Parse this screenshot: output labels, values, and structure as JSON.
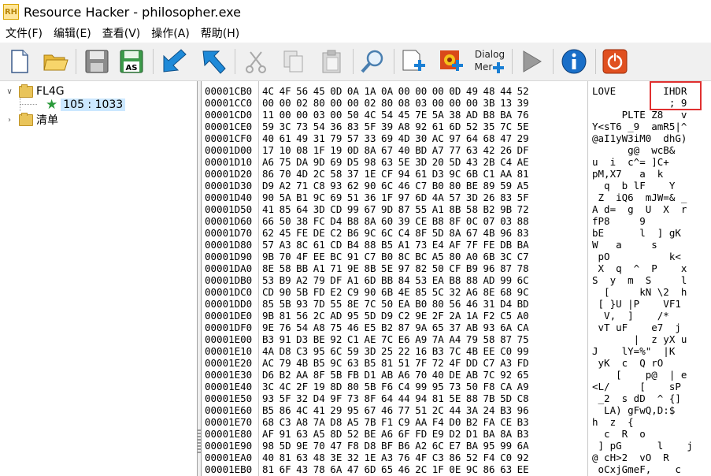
{
  "window": {
    "title": "Resource Hacker - philosopher.exe",
    "logo": "RH"
  },
  "menu": [
    "文件(F)",
    "编辑(E)",
    "查看(V)",
    "操作(A)",
    "帮助(H)"
  ],
  "toolbar": {
    "buttons": [
      "new-file-icon",
      "open-folder-icon",
      "save-icon",
      "save-as-icon",
      "back-arrow-icon",
      "forward-arrow-icon",
      "cut-icon",
      "copy-icon",
      "paste-icon",
      "search-icon",
      "add-resource-icon",
      "add-image-icon",
      "dialog-menu-icon",
      "play-icon",
      "info-icon",
      "power-icon"
    ],
    "save_as_label": "AS",
    "dialog_label_1": "Dialog",
    "dialog_label_2": "Mer"
  },
  "tree": {
    "root": "FL4G",
    "child": "105 : 1033",
    "sibling": "清单"
  },
  "hex": {
    "rows": [
      {
        "addr": "00001CB0",
        "bytes": "4C 4F 56 45 0D 0A 1A 0A 00 00 00 0D 49 48 44 52",
        "ascii": "LOVE        IHDR"
      },
      {
        "addr": "00001CC0",
        "bytes": "00 00 02 80 00 00 02 80 08 03 00 00 00 3B 13 39",
        "ascii": "             ; 9"
      },
      {
        "addr": "00001CD0",
        "bytes": "11 00 00 03 00 50 4C 54 45 7E 5A 38 AD B8 BA 76",
        "ascii": "     PLTE Z8   v"
      },
      {
        "addr": "00001CE0",
        "bytes": "59 3C 73 54 36 83 5F 39 A8 92 61 6D 52 35 7C 5E",
        "ascii": "Y<sT6 _9  amR5|^"
      },
      {
        "addr": "00001CF0",
        "bytes": "40 61 49 31 79 57 33 69 4D 30 AC 97 64 68 47 29",
        "ascii": "@aI1yW3iM0  dhG)"
      },
      {
        "addr": "00001D00",
        "bytes": "17 10 08 1F 19 0D 8A 67 40 BD A7 77 63 42 26 DF",
        "ascii": "      g@  wcB&"
      },
      {
        "addr": "00001D10",
        "bytes": "A6 75 DA 9D 69 D5 98 63 5E 3D 20 5D 43 2B C4 AE",
        "ascii": "u  i  c^= ]C+"
      },
      {
        "addr": "00001D20",
        "bytes": "86 70 4D 2C 58 37 1E CF 94 61 D3 9C 6B C1 AA 81",
        "ascii": "pM,X7   a  k"
      },
      {
        "addr": "00001D30",
        "bytes": "D9 A2 71 C8 93 62 90 6C 46 C7 B0 80 BE 89 59 A5",
        "ascii": "  q  b lF    Y"
      },
      {
        "addr": "00001D40",
        "bytes": "90 5A B1 9C 69 51 36 1F 97 6D 4A 57 3D 26 83 5F",
        "ascii": " Z  iQ6  mJW=& _"
      },
      {
        "addr": "00001D50",
        "bytes": "41 85 64 3D CD 99 67 9D 87 55 A1 8B 58 B2 9B 72",
        "ascii": "A d=  g  U  X  r"
      },
      {
        "addr": "00001D60",
        "bytes": "66 50 38 FC D4 B8 8A 60 39 CE B8 8F 0C 07 03 88",
        "ascii": "fP8     9"
      },
      {
        "addr": "00001D70",
        "bytes": "62 45 FE DE C2 B6 9C 6C C4 8F 5D 8A 67 4B 96 83",
        "ascii": "bE      l  ] gK"
      },
      {
        "addr": "00001D80",
        "bytes": "57 A3 8C 61 CD B4 88 B5 A1 73 E4 AF 7F FE DB BA",
        "ascii": "W   a     s"
      },
      {
        "addr": "00001D90",
        "bytes": "9B 70 4F EE BC 91 C7 B0 8C BC A5 80 A0 6B 3C C7",
        "ascii": " pO          k<"
      },
      {
        "addr": "00001DA0",
        "bytes": "8E 58 BB A1 71 9E 8B 5E 97 82 50 CF B9 96 87 78",
        "ascii": " X  q  ^  P    x"
      },
      {
        "addr": "00001DB0",
        "bytes": "53 B9 A2 79 DF A1 6D BB 84 53 EA B8 88 AD 99 6C",
        "ascii": "S  y  m  S     l"
      },
      {
        "addr": "00001DC0",
        "bytes": "CD 90 5B FD E2 C9 90 6B 4E 85 5C 32 A6 8E 68 9C",
        "ascii": "  [     kN \\2  h"
      },
      {
        "addr": "00001DD0",
        "bytes": "85 5B 93 7D 55 8E 7C 50 EA B0 80 56 46 31 D4 BD",
        "ascii": " [ }U |P    VF1"
      },
      {
        "addr": "00001DE0",
        "bytes": "9B 81 56 2C AD 95 5D D9 C2 9E 2F 2A 1A F2 C5 A0",
        "ascii": "  V,  ]    /*"
      },
      {
        "addr": "00001DF0",
        "bytes": "9E 76 54 A8 75 46 E5 B2 87 9A 65 37 AB 93 6A CA",
        "ascii": " vT uF    e7  j"
      },
      {
        "addr": "00001E00",
        "bytes": "B3 91 D3 BE 92 C1 AE 7C E6 A9 7A A4 79 58 87 75",
        "ascii": "       |  z yX u"
      },
      {
        "addr": "00001E10",
        "bytes": "4A D8 C3 95 6C 59 3D 25 22 16 B3 7C 4B EE C0 99",
        "ascii": "J    lY=%\"  |K"
      },
      {
        "addr": "00001E20",
        "bytes": "AC 79 4B B5 9C 63 B5 81 51 7F 72 4F DD C7 A3 FD",
        "ascii": " yK  c  Q rO"
      },
      {
        "addr": "00001E30",
        "bytes": "D6 B2 AA 8F 5B FB D1 AB A6 70 40 DE AB 7C 92 65",
        "ascii": "    [    p@  | e"
      },
      {
        "addr": "00001E40",
        "bytes": "3C 4C 2F 19 8D 80 5B F6 C4 99 95 73 50 F8 CA A9",
        "ascii": "<L/     [    sP"
      },
      {
        "addr": "00001E50",
        "bytes": "93 5F 32 D4 9F 73 8F 64 44 94 81 5E 88 7B 5D C8",
        "ascii": " _2  s dD  ^ {]"
      },
      {
        "addr": "00001E60",
        "bytes": "B5 86 4C 41 29 95 67 46 77 51 2C 44 3A 24 B3 96",
        "ascii": "  LA) gFwQ,D:$"
      },
      {
        "addr": "00001E70",
        "bytes": "68 C3 A8 7A D8 A5 7B F1 C9 AA F4 D0 B2 FA CE B3",
        "ascii": "h  z  {"
      },
      {
        "addr": "00001E80",
        "bytes": "AF 91 63 A5 8D 52 BE A6 6F FD E9 D2 D1 BA 8A B3",
        "ascii": "  c  R  o"
      },
      {
        "addr": "00001E90",
        "bytes": "98 5D 9E 70 47 F8 D8 BF B6 A2 6C E7 BA 95 99 6A",
        "ascii": " ] pG      l    j"
      },
      {
        "addr": "00001EA0",
        "bytes": "40 81 63 48 3E 32 1E A3 76 4F C3 86 52 F4 C0 92",
        "ascii": "@ cH>2  vO  R"
      },
      {
        "addr": "00001EB0",
        "bytes": "81 6F 43 78 6A 47 6D 65 46 2C 1F 0E 9C 86 63 EE",
        "ascii": " oCxjGmeF,    c"
      }
    ]
  },
  "colors": {
    "highlight_box": "#e03030",
    "selection": "#cce8ff",
    "accent": "#1a7fd4"
  }
}
